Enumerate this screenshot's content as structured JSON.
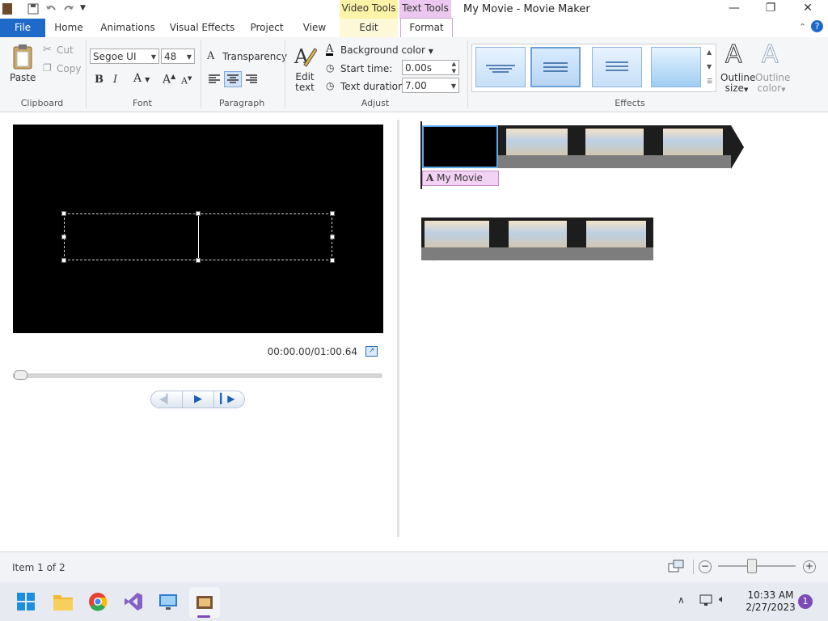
{
  "window": {
    "title": "My Movie - Movie Maker",
    "context_tabs": {
      "video_tools": "Video Tools",
      "text_tools": "Text Tools"
    },
    "controls": {
      "minimize": "—",
      "maximize": "❐",
      "close": "✕"
    }
  },
  "tabs": [
    "File",
    "Home",
    "Animations",
    "Visual Effects",
    "Project",
    "View",
    "Edit",
    "Format"
  ],
  "ribbon": {
    "clipboard": {
      "paste": "Paste",
      "cut": "Cut",
      "copy": "Copy",
      "label": "Clipboard"
    },
    "font": {
      "family": "Segoe UI",
      "size": "48",
      "transparency": "Transparency",
      "label": "Font",
      "bold": "B",
      "italic": "I",
      "color": "A",
      "grow": "A",
      "shrink": "A"
    },
    "paragraph": {
      "label": "Paragraph"
    },
    "adjust": {
      "edit_text": "Edit text",
      "background_color": "Background color",
      "start_time_label": "Start time:",
      "start_time": "0.00s",
      "text_duration_label": "Text duration:",
      "text_duration": "7.00",
      "label": "Adjust"
    },
    "effects": {
      "label": "Effects"
    },
    "outline": {
      "size": "Outline size",
      "color": "Outline color"
    }
  },
  "preview": {
    "timecode": "00:00.00/01:00.64"
  },
  "storyboard": {
    "caption": "My Movie"
  },
  "status": {
    "item": "Item 1 of 2"
  },
  "taskbar": {
    "time": "10:33 AM",
    "date": "2/27/2023",
    "notifications": "1"
  },
  "colors": {
    "accent": "#1f6ac9",
    "text_tools": "#ecc8f0",
    "video_tools": "#fbf3a6"
  }
}
